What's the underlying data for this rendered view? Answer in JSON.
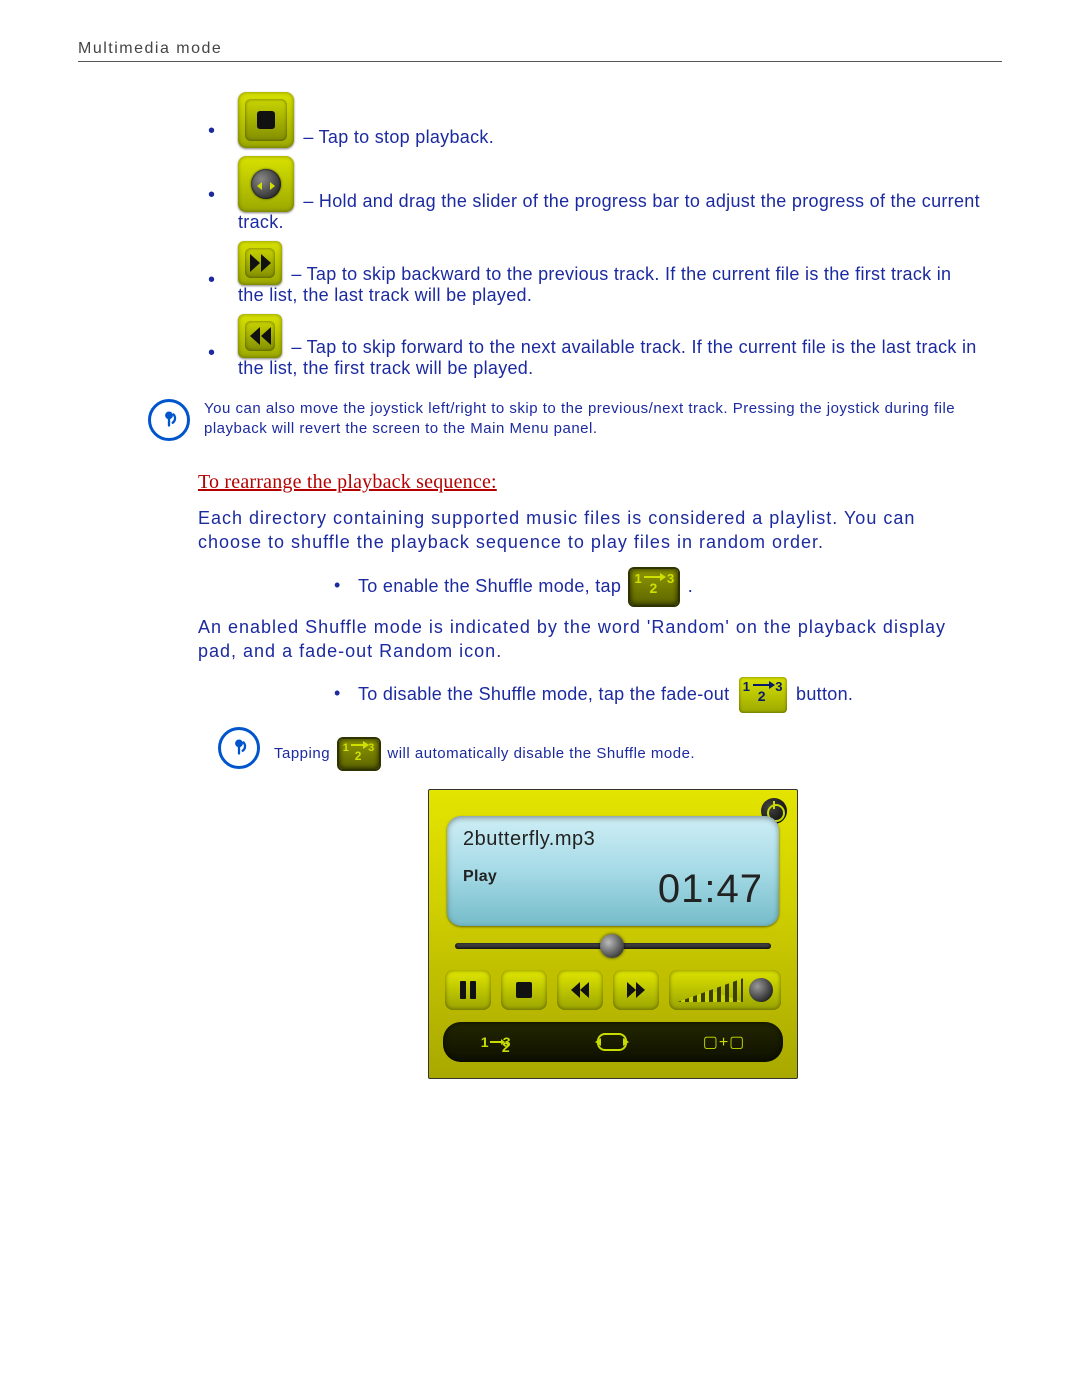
{
  "header": {
    "title": "Multimedia mode"
  },
  "bullets": {
    "stop": " – Tap to stop playback.",
    "slider": " – Hold and drag the slider of the progress bar to adjust the progress of the current track.",
    "skipBack": " – Tap to skip backward to the previous track. If the current file is the first track in the list, the last track will be played.",
    "skipFwd": " – Tap to skip forward to the next available track. If the current file is the last track in the list, the first track will be played."
  },
  "note1": "You can also move the joystick left/right to skip to the previous/next track. Pressing the joystick during file playback will revert the screen to the Main Menu panel.",
  "section": {
    "heading": "To rearrange the playback sequence:",
    "intro": "Each directory containing supported music files is considered a playlist. You can choose to shuffle the playback sequence to play files in random order.",
    "enable_pre": "To enable the Shuffle mode, tap ",
    "enable_post": ".",
    "enabledDesc": "An enabled Shuffle mode is indicated by the word 'Random' on the playback display pad, and a fade-out Random icon.",
    "disable_pre": "To disable the Shuffle mode, tap the fade-out",
    "disable_post": " button."
  },
  "note2_pre": "Tapping ",
  "note2_post": " will automatically disable the Shuffle mode.",
  "player": {
    "filename": "2butterfly.mp3",
    "state": "Play",
    "time": "01:47"
  }
}
